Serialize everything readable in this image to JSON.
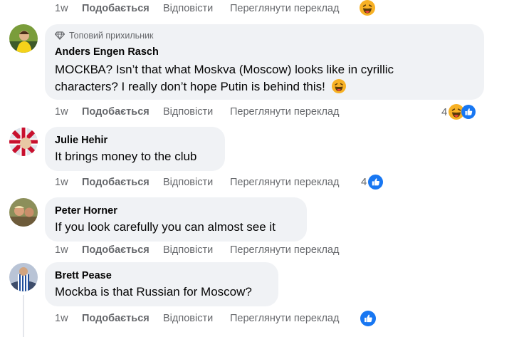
{
  "actions": {
    "time": "1w",
    "like": "Подобається",
    "reply": "Відповісти",
    "translate": "Переглянути переклад"
  },
  "comments": [
    {
      "badge": "Топовий прихильник",
      "author": "Anders Engen Rasch",
      "lines": [
        "МОСКВА? Isn’t that what Moskva (Moscow) looks like in cyrillic",
        "characters? I really don’t hope Putin is behind this!"
      ],
      "reactions": {
        "count": "4",
        "types": [
          "haha",
          "like"
        ]
      }
    },
    {
      "author": "Julie Hehir",
      "lines": [
        "It brings money to the club"
      ],
      "reactions": {
        "count": "4",
        "types": [
          "like"
        ]
      }
    },
    {
      "author": "Peter Horner",
      "lines": [
        "If you look carefully you can almost see it"
      ]
    },
    {
      "author": "Brett Pease",
      "lines": [
        "Mockba is that Russian for Moscow?"
      ],
      "reactions": {
        "types": [
          "like"
        ]
      }
    }
  ],
  "colors": {
    "like_blue": "#1877f2",
    "haha_yellow": "#f7b125",
    "bubble": "#f0f2f5",
    "meta_gray": "#65676b"
  },
  "icons": [
    "diamond-icon",
    "grinning-emoji-icon",
    "haha-reaction-icon",
    "like-reaction-icon"
  ]
}
